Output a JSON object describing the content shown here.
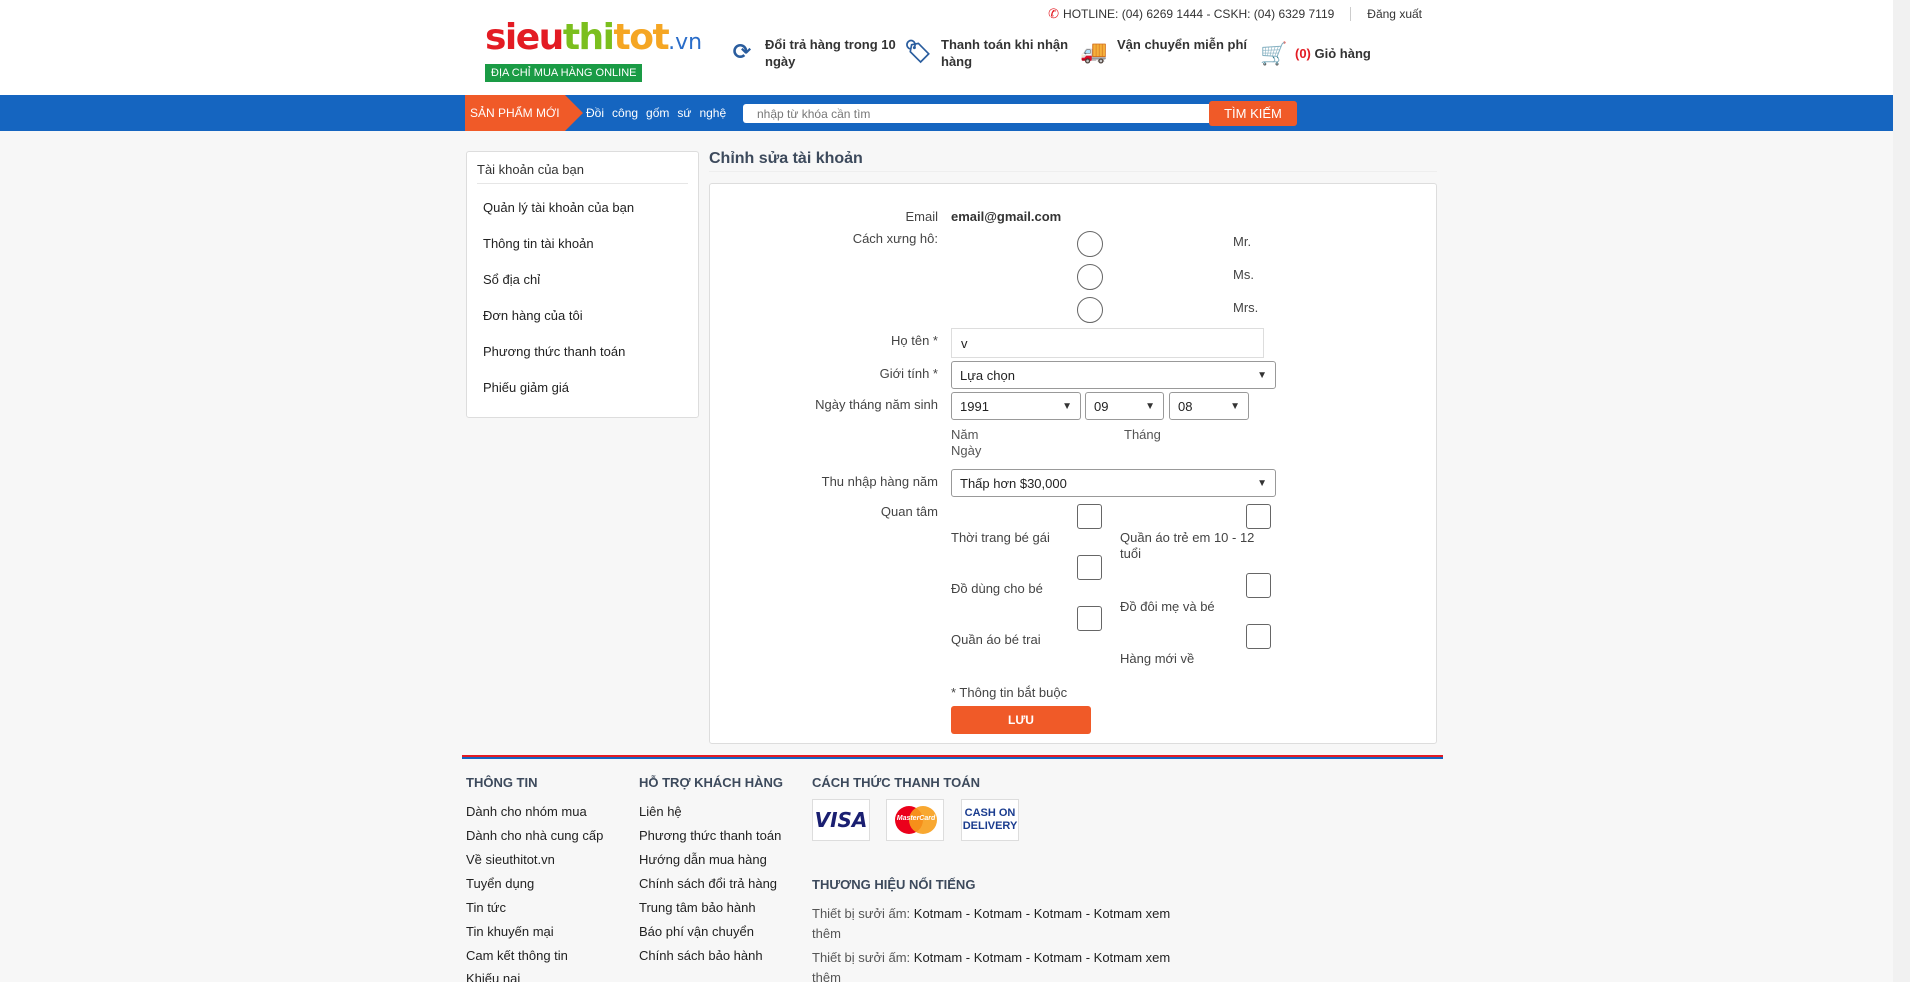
{
  "header": {
    "logo": {
      "part1": "sieu",
      "part2": "thi",
      "part3": "tot",
      "domain": ".vn",
      "tagline": "ĐỊA CHỈ MUA HÀNG ONLINE"
    },
    "hotline": "HOTLINE: (04) 6269 1444 - CSKH: (04) 6329 7119",
    "logout": "Đăng xuất",
    "features": [
      {
        "icon": "refresh-icon",
        "line1": "Đổi trả hàng trong 10",
        "line2": "ngày"
      },
      {
        "icon": "tag-icon",
        "line1": "Thanh toán khi nhận",
        "line2": "hàng"
      },
      {
        "icon": "truck-icon",
        "line1": "Vận chuyển miễn phí",
        "line2": ""
      }
    ],
    "cart_count": "(0)",
    "cart_label": "Giỏ hàng"
  },
  "nav": {
    "new_products": "SẢN PHẨM MỚI",
    "links": [
      "Đồi",
      "công",
      "gốm",
      "sứ",
      "nghệ"
    ],
    "search_placeholder": "nhập từ khóa cần tìm",
    "search_button": "TÌM KIẾM"
  },
  "sidebar": {
    "title": "Tài khoản của bạn",
    "items": [
      "Quản lý tài khoản của bạn",
      "Thông tin tài khoản",
      "Sổ địa chỉ",
      "Đơn hàng của tôi",
      "Phương thức thanh toán",
      "Phiếu giảm giá"
    ]
  },
  "form": {
    "title": "Chỉnh sửa tài khoản",
    "email_label": "Email",
    "email_value": "email@gmail.com",
    "salutation_label": "Cách xưng hô:",
    "salutations": [
      "Mr.",
      "Ms.",
      "Mrs."
    ],
    "name_label": "Họ tên *",
    "name_value": "v",
    "gender_label": "Giới tính *",
    "gender_value": "Lựa chọn",
    "dob_label": "Ngày tháng năm sinh",
    "dob_year": "1991",
    "dob_month": "09",
    "dob_day": "08",
    "dob_year_caption": "Năm",
    "dob_month_caption": "Tháng",
    "dob_day_caption": "Ngày",
    "income_label": "Thu nhập hàng năm",
    "income_value": "Thấp hơn $30,000",
    "interest_label": "Quan tâm",
    "interests_left": [
      "Thời trang bé gái",
      "Đồ dùng cho bé",
      "Quần áo bé trai"
    ],
    "interests_right": [
      "Quần áo trẻ em 10 - 12 tuổi",
      "Đồ đôi mẹ và bé",
      "Hàng mới về"
    ],
    "required_note": "* Thông tin bắt buộc",
    "save_label": "LƯU"
  },
  "footer": {
    "info_title": "THÔNG TIN",
    "info_links": [
      "Dành cho nhóm mua",
      "Dành cho nhà cung cấp",
      "Về sieuthitot.vn",
      "Tuyển dụng",
      "Tin tức",
      "Tin khuyến mại",
      "Cam kết thông tin",
      "Khiếu nại"
    ],
    "support_title": "HỖ TRỢ KHÁCH HÀNG",
    "support_links": [
      "Liên hệ",
      "Phương thức thanh toán",
      "Hướng dẫn mua hàng",
      "Chính sách đổi trả hàng",
      "Trung tâm bảo hành",
      "Báo phí vận chuyển",
      "Chính sách bảo hành"
    ],
    "payment_title": "CÁCH THỨC THANH TOÁN",
    "payment_visa": "VISA",
    "payment_mastercard": "MasterCard",
    "payment_cod_1": "CASH ON",
    "payment_cod_2": "DELIVERY",
    "brands_title": "THƯƠNG HIỆU NỔI TIẾNG",
    "brand_row_prefix": "Thiết bị sưởi ấm:",
    "brand_row_links": "Kotmam - Kotmam - Kotmam - Kotmam xem",
    "brand_row_more": "thêm"
  },
  "colors": {
    "accent": "#f05a28",
    "nav_blue": "#1565c0",
    "logo_green": "#1a9b45"
  }
}
